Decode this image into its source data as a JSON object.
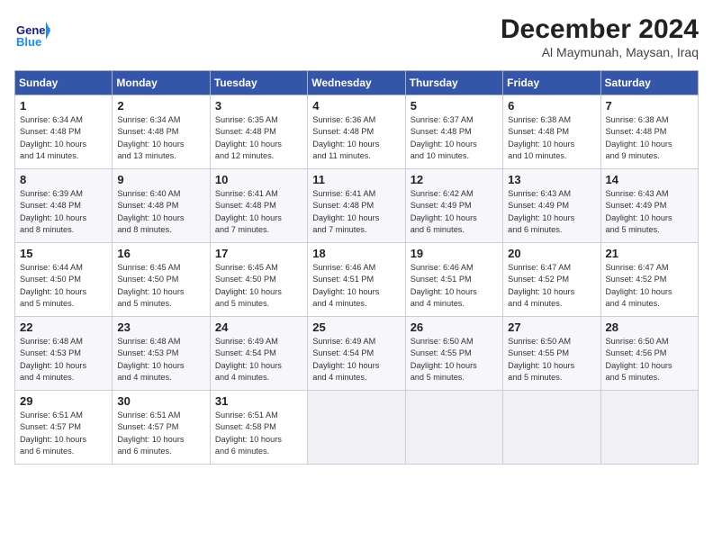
{
  "header": {
    "logo_general": "General",
    "logo_blue": "Blue",
    "month_title": "December 2024",
    "subtitle": "Al Maymunah, Maysan, Iraq"
  },
  "days_of_week": [
    "Sunday",
    "Monday",
    "Tuesday",
    "Wednesday",
    "Thursday",
    "Friday",
    "Saturday"
  ],
  "weeks": [
    [
      {
        "day": "1",
        "info": "Sunrise: 6:34 AM\nSunset: 4:48 PM\nDaylight: 10 hours\nand 14 minutes."
      },
      {
        "day": "2",
        "info": "Sunrise: 6:34 AM\nSunset: 4:48 PM\nDaylight: 10 hours\nand 13 minutes."
      },
      {
        "day": "3",
        "info": "Sunrise: 6:35 AM\nSunset: 4:48 PM\nDaylight: 10 hours\nand 12 minutes."
      },
      {
        "day": "4",
        "info": "Sunrise: 6:36 AM\nSunset: 4:48 PM\nDaylight: 10 hours\nand 11 minutes."
      },
      {
        "day": "5",
        "info": "Sunrise: 6:37 AM\nSunset: 4:48 PM\nDaylight: 10 hours\nand 10 minutes."
      },
      {
        "day": "6",
        "info": "Sunrise: 6:38 AM\nSunset: 4:48 PM\nDaylight: 10 hours\nand 10 minutes."
      },
      {
        "day": "7",
        "info": "Sunrise: 6:38 AM\nSunset: 4:48 PM\nDaylight: 10 hours\nand 9 minutes."
      }
    ],
    [
      {
        "day": "8",
        "info": "Sunrise: 6:39 AM\nSunset: 4:48 PM\nDaylight: 10 hours\nand 8 minutes."
      },
      {
        "day": "9",
        "info": "Sunrise: 6:40 AM\nSunset: 4:48 PM\nDaylight: 10 hours\nand 8 minutes."
      },
      {
        "day": "10",
        "info": "Sunrise: 6:41 AM\nSunset: 4:48 PM\nDaylight: 10 hours\nand 7 minutes."
      },
      {
        "day": "11",
        "info": "Sunrise: 6:41 AM\nSunset: 4:48 PM\nDaylight: 10 hours\nand 7 minutes."
      },
      {
        "day": "12",
        "info": "Sunrise: 6:42 AM\nSunset: 4:49 PM\nDaylight: 10 hours\nand 6 minutes."
      },
      {
        "day": "13",
        "info": "Sunrise: 6:43 AM\nSunset: 4:49 PM\nDaylight: 10 hours\nand 6 minutes."
      },
      {
        "day": "14",
        "info": "Sunrise: 6:43 AM\nSunset: 4:49 PM\nDaylight: 10 hours\nand 5 minutes."
      }
    ],
    [
      {
        "day": "15",
        "info": "Sunrise: 6:44 AM\nSunset: 4:50 PM\nDaylight: 10 hours\nand 5 minutes."
      },
      {
        "day": "16",
        "info": "Sunrise: 6:45 AM\nSunset: 4:50 PM\nDaylight: 10 hours\nand 5 minutes."
      },
      {
        "day": "17",
        "info": "Sunrise: 6:45 AM\nSunset: 4:50 PM\nDaylight: 10 hours\nand 5 minutes."
      },
      {
        "day": "18",
        "info": "Sunrise: 6:46 AM\nSunset: 4:51 PM\nDaylight: 10 hours\nand 4 minutes."
      },
      {
        "day": "19",
        "info": "Sunrise: 6:46 AM\nSunset: 4:51 PM\nDaylight: 10 hours\nand 4 minutes."
      },
      {
        "day": "20",
        "info": "Sunrise: 6:47 AM\nSunset: 4:52 PM\nDaylight: 10 hours\nand 4 minutes."
      },
      {
        "day": "21",
        "info": "Sunrise: 6:47 AM\nSunset: 4:52 PM\nDaylight: 10 hours\nand 4 minutes."
      }
    ],
    [
      {
        "day": "22",
        "info": "Sunrise: 6:48 AM\nSunset: 4:53 PM\nDaylight: 10 hours\nand 4 minutes."
      },
      {
        "day": "23",
        "info": "Sunrise: 6:48 AM\nSunset: 4:53 PM\nDaylight: 10 hours\nand 4 minutes."
      },
      {
        "day": "24",
        "info": "Sunrise: 6:49 AM\nSunset: 4:54 PM\nDaylight: 10 hours\nand 4 minutes."
      },
      {
        "day": "25",
        "info": "Sunrise: 6:49 AM\nSunset: 4:54 PM\nDaylight: 10 hours\nand 4 minutes."
      },
      {
        "day": "26",
        "info": "Sunrise: 6:50 AM\nSunset: 4:55 PM\nDaylight: 10 hours\nand 5 minutes."
      },
      {
        "day": "27",
        "info": "Sunrise: 6:50 AM\nSunset: 4:55 PM\nDaylight: 10 hours\nand 5 minutes."
      },
      {
        "day": "28",
        "info": "Sunrise: 6:50 AM\nSunset: 4:56 PM\nDaylight: 10 hours\nand 5 minutes."
      }
    ],
    [
      {
        "day": "29",
        "info": "Sunrise: 6:51 AM\nSunset: 4:57 PM\nDaylight: 10 hours\nand 6 minutes."
      },
      {
        "day": "30",
        "info": "Sunrise: 6:51 AM\nSunset: 4:57 PM\nDaylight: 10 hours\nand 6 minutes."
      },
      {
        "day": "31",
        "info": "Sunrise: 6:51 AM\nSunset: 4:58 PM\nDaylight: 10 hours\nand 6 minutes."
      },
      null,
      null,
      null,
      null
    ]
  ]
}
